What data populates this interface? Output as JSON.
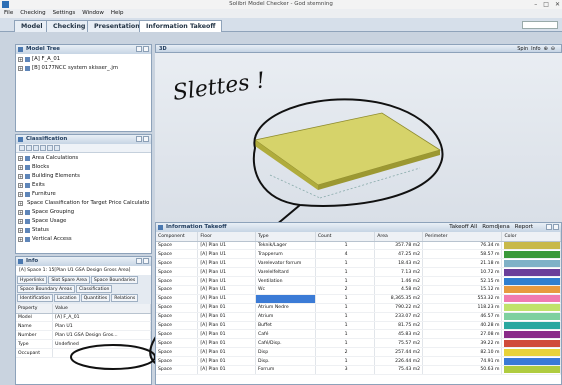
{
  "window": {
    "title": "Solibri Model Checker - God stemning",
    "controls": [
      "–",
      "□",
      "✕"
    ]
  },
  "menu": [
    "File",
    "Checking",
    "Settings",
    "Window",
    "Help"
  ],
  "tabs": [
    "Model",
    "Checking",
    "Presentation",
    "Information Takeoff"
  ],
  "model_tree": {
    "title": "Model Tree",
    "items": [
      "[A] F_A_01",
      "[B] 0177NCC system skisser_.jm"
    ]
  },
  "classification": {
    "title": "Classification",
    "items": [
      "Area Calculations",
      "Blocks",
      "Building Elements",
      "Exits",
      "Furniture",
      "Space Classification for Target Price Calculation",
      "Space Grouping",
      "Space Usage",
      "Status",
      "Vertical Access"
    ]
  },
  "info": {
    "title": "Info",
    "selection": "[A] Space 1: 15[Plan U1 GSA Design Gross Area]",
    "tabs": [
      "Hyperlinks",
      "Slot Spare Area",
      "Space Boundaries",
      "Space Boundary Areas",
      "Classification",
      "Identification",
      "Location",
      "Quantities",
      "Relations"
    ],
    "prop_headers": [
      "Property",
      "Value"
    ],
    "props": [
      [
        "Model",
        "[A] F_A_01"
      ],
      [
        "Name",
        "Plan U1"
      ],
      [
        "Number",
        "Plan U1 GSA Design Gros..."
      ],
      [
        "Type",
        "Undefined"
      ],
      [
        "Occupant",
        ""
      ]
    ]
  },
  "viewport": {
    "title": "3D",
    "toolbar": [
      "Spin",
      "Info"
    ],
    "annotation": "Slettes !"
  },
  "takeoff": {
    "title": "Information Takeoff",
    "toolbar": [
      "Takeoff All",
      "Romdjena",
      "Report"
    ],
    "headers": [
      "Component",
      "Floor",
      "Type",
      "Count",
      "Area",
      "Perimeter",
      "Color"
    ],
    "rows": [
      [
        "Space",
        "[A] Plan U1",
        "Teknik/Lager",
        "1",
        "357.78 m2",
        "76.34 m",
        "#c8b94a"
      ],
      [
        "Space",
        "[A] Plan U1",
        "Trapperum",
        "4",
        "47.25 m2",
        "58.57 m",
        "#3a9a3a"
      ],
      [
        "Space",
        "[A] Plan U1",
        "Varelevator forrum",
        "1",
        "18.43 m2",
        "21.18 m",
        "#7fb1c7"
      ],
      [
        "Space",
        "[A] Plan U1",
        "Varelelfeltard",
        "1",
        "7.13 m2",
        "10.72 m",
        "#6b3f9a"
      ],
      [
        "Space",
        "[A] Plan U1",
        "Ventilation",
        "1",
        "1.46 m2",
        "52.15 m",
        "#2f7fd0"
      ],
      [
        "Space",
        "[A] Plan U1",
        "Wc",
        "2",
        "4.58 m2",
        "15.12 m",
        "#e79a3f"
      ],
      [
        "Space",
        "[A] Plan U1",
        "",
        "1",
        "8,365.35 m2",
        "553.32 m",
        "#f07ab0"
      ],
      [
        "Space",
        "[A] Plan 01",
        "Atrium Nedre",
        "1",
        "790.22 m2",
        "118.23 m",
        "#c0e26a"
      ],
      [
        "Space",
        "[A] Plan 01",
        "Atrium",
        "1",
        "233.07 m2",
        "46.57 m",
        "#7ed0a0"
      ],
      [
        "Space",
        "[A] Plan 01",
        "Buffet",
        "1",
        "81.75 m2",
        "40.28 m",
        "#2aa7a0"
      ],
      [
        "Space",
        "[A] Plan 01",
        "Café",
        "1",
        "45.83 m2",
        "27.08 m",
        "#8a2b8a"
      ],
      [
        "Space",
        "[A] Plan 01",
        "Café/Disp.",
        "1",
        "75.57 m2",
        "39.22 m",
        "#d04a3a"
      ],
      [
        "Space",
        "[A] Plan 01",
        "Disp",
        "2",
        "257.44 m2",
        "82.10 m",
        "#e8d23a"
      ],
      [
        "Space",
        "[A] Plan 01",
        "Disp.",
        "1",
        "226.44 m2",
        "74.91 m",
        "#3a7ad6"
      ],
      [
        "Space",
        "[A] Plan 01",
        "Forrum",
        "3",
        "75.43 m2",
        "50.63 m",
        "#b0cc40"
      ]
    ]
  }
}
